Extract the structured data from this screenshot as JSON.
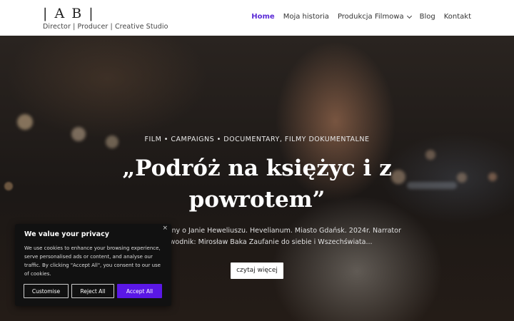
{
  "header": {
    "logo": "| A B |",
    "tagline": "Director | Producer | Creative Studio",
    "nav": [
      {
        "label": "Home"
      },
      {
        "label": "Moja historia"
      },
      {
        "label": "Produkcja Filmowa"
      },
      {
        "label": "Blog"
      },
      {
        "label": "Kontakt"
      }
    ]
  },
  "hero": {
    "categories": "FILM • CAMPAIGNS • DOCUMENTARY, FILMY DOKUMENTALNE",
    "title": "„Podróż na księżyc i z powrotem”",
    "excerpt": "alny o Janie Heweliuszu. Hevelianum. Miasto Gdańsk. 2024r. Narrator i wodnik: Mirosław Baka Zaufanie do siebie i Wszechświata...",
    "read_more": "czytaj więcej"
  },
  "cookie": {
    "title": "We value your privacy",
    "text": "We use cookies to enhance your browsing experience, serve personalised ads or content, and analyse our traffic. By clicking \"Accept All\", you consent to our use of cookies.",
    "customise": "Customise",
    "reject": "Reject All",
    "accept": "Accept All",
    "close": "×"
  },
  "colors": {
    "accent": "#5b2bd6",
    "accept_button": "#5a17e6"
  },
  "icons": {
    "dropdown": "chevron-down-icon",
    "close": "close-icon"
  }
}
